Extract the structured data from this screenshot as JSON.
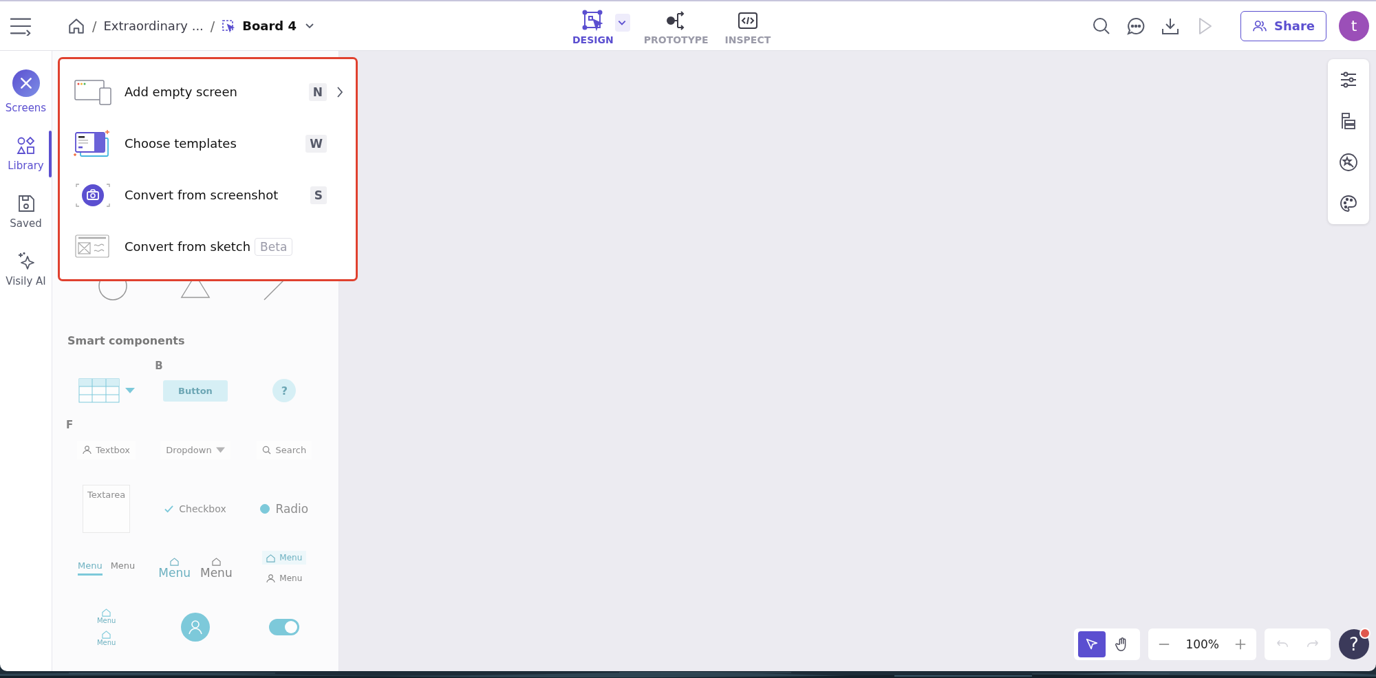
{
  "header": {
    "breadcrumb": [
      {
        "separator": "/",
        "label": "Extraordinary ..."
      },
      {
        "separator": "/",
        "label": "Board 4"
      }
    ],
    "modes": [
      {
        "label": "DESIGN",
        "kind": "design",
        "selected": true
      },
      {
        "label": "PROTOTYPE",
        "kind": "prototype",
        "selected": false
      },
      {
        "label": "INSPECT",
        "kind": "inspect",
        "selected": false
      }
    ],
    "share": "Share",
    "avatar": "t"
  },
  "rail": [
    {
      "label": "Screens",
      "kind": "screens",
      "open": true,
      "selected": false
    },
    {
      "label": "Library",
      "kind": "library",
      "selected": true
    },
    {
      "label": "Saved",
      "kind": "saved",
      "selected": false
    },
    {
      "label": "Visily AI",
      "kind": "ai",
      "selected": false
    }
  ],
  "add_menu": {
    "items": [
      {
        "kind": "screen",
        "label": "Add empty screen",
        "shortcut": "N",
        "submenu": true
      },
      {
        "kind": "templates",
        "label": "Choose templates",
        "shortcut": "W",
        "submenu": false
      },
      {
        "kind": "screenshot",
        "label": "Convert from screenshot",
        "shortcut": "S",
        "submenu": false
      },
      {
        "kind": "sketch",
        "label": "Convert from sketch",
        "badge": "Beta",
        "submenu": false
      }
    ]
  },
  "library": {
    "section_title": "Smart components",
    "components": [
      {
        "kind": "table"
      },
      {
        "kind": "button",
        "label": "Button",
        "mark": "B"
      },
      {
        "kind": "help",
        "label": "?"
      },
      {
        "kind": "textbox",
        "label": "Textbox",
        "mark": "F"
      },
      {
        "kind": "dropdown",
        "label": "Dropdown"
      },
      {
        "kind": "search",
        "label": "Search"
      },
      {
        "kind": "textarea",
        "label": "Textarea"
      },
      {
        "kind": "checkbox",
        "label": "Checkbox",
        "checked": true
      },
      {
        "kind": "radio",
        "label": "Radio",
        "checked": true
      },
      {
        "kind": "tabs",
        "labels": [
          "Menu",
          "Menu"
        ]
      },
      {
        "kind": "bottom_nav",
        "labels": [
          "Menu",
          "Menu"
        ]
      },
      {
        "kind": "side_nav",
        "labels": [
          "Menu",
          "Menu"
        ]
      },
      {
        "kind": "vertical_nav",
        "labels": [
          "Menu",
          "Menu"
        ]
      },
      {
        "kind": "avatar"
      },
      {
        "kind": "toggle",
        "on": true
      }
    ]
  },
  "canvas_tools": {
    "tools": [
      {
        "kind": "pointer",
        "selected": true
      },
      {
        "kind": "hand",
        "selected": false
      }
    ],
    "zoom": "100%",
    "undo_disabled": true,
    "redo_disabled": true,
    "help": "?",
    "help_notification": true
  }
}
